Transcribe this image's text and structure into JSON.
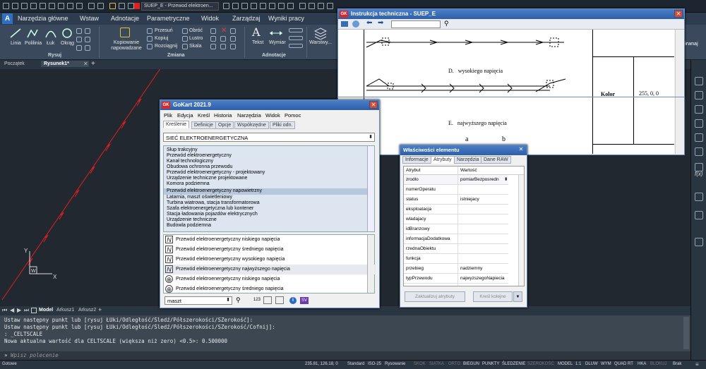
{
  "app": {
    "doc_title": "SUEP_E - Przewod elektroen..."
  },
  "ribbon_tabs": [
    "Narzędzia główne",
    "Wstaw",
    "Adnotacje",
    "Parametryczne",
    "Widok",
    "Zarządzaj",
    "Wyniki pracy"
  ],
  "ribbon": {
    "rysuj": {
      "label": "Rysuj",
      "items": [
        "Linia",
        "Polilinia",
        "Łuk",
        "Okrąg"
      ]
    },
    "zmiana": {
      "label": "Zmiana",
      "items": [
        "Przesuń",
        "Kopiuj",
        "Rozciągnij",
        "Obróć",
        "Lustro",
        "Skala"
      ],
      "copy_label": "Kopiowanie napowadzane"
    },
    "adnotacje": {
      "label": "Adnotacje",
      "items": [
        "Tekst",
        "Wymiar"
      ]
    },
    "warstwy": "Warstwy...",
    "right_cut": "órwnaj"
  },
  "doc_tabs": [
    "Początek",
    "Rysunek1*"
  ],
  "layout_tabs": [
    "Model",
    "Arkusz1",
    "Arkusz2"
  ],
  "command": {
    "lines": [
      "Ustaw następny punkt lub [rysuj ŁUki/Odległość/Śledź/Półszerokości/SZerokość]:",
      "Ustaw następny punkt lub [rysuj ŁUki/Odległość/Śledź/Półszerokości/SZerokość/Cofnij]:",
      ": _CELTSCALE",
      "Nowa aktualna wartość dla CELTSCALE (większa niż zero) <0.5>: 0.500000"
    ],
    "placeholder": "Wpisz polecenie"
  },
  "status": {
    "left": "Gotowe",
    "coords": "235.81, 126.18, 0",
    "items": [
      "Standard",
      "ISO-25",
      "Rysowanie",
      "SKOK",
      "SIATKA",
      "ORTO",
      "BIEGUN",
      "PUNKTY",
      "ŚLEDZENIE",
      "SZEROKOŚĆ",
      "MODEL",
      "1:1",
      "DLUW",
      "WYM",
      "QUAD",
      "RT",
      "HKA",
      "BLOKUJ",
      "Brak"
    ]
  },
  "instr": {
    "title": "Instrukcja techniczna - SUEP_E",
    "caption_d": "D.   wysokiego napięcia",
    "caption_e": "E.   najwyższego napięcia",
    "kolor": "Kolor RGB",
    "rgb": "255, 0, 0",
    "a": "a",
    "b": "b"
  },
  "gokart": {
    "title": "GoKart 2021.9",
    "menu": [
      "Plik",
      "Edycja",
      "Kreśl",
      "Historia",
      "Narzędzia",
      "Widok",
      "Pomoc"
    ],
    "tabs": [
      "Kreślenie",
      "Definicje",
      "Opcje",
      "Współrzędne",
      "Pliki odn."
    ],
    "category": "SIEĆ ELEKTROENERGETYCZNA",
    "items": [
      "Słup trakcyjny",
      "Przewód elektroenergetyczny",
      "Kanał technologiczny",
      "Obudowa ochronna przewodu",
      "Przewód elektroenergetyczny - projektowany",
      "Urządzenie techniczne projektowane",
      "Komora podziemna",
      "Przewód elektroenergetyczny napowietrzny",
      "Latarnia, maszt oświetleniowy",
      "Turbina wiatrowa, stacja transformatorowa",
      "Szafa elektroenergetyczna lub kontener",
      "Stacja ładowania pojazdów elektrycznych",
      "Urządzenie techniczne",
      "Budowla podziemna"
    ],
    "selected": "Przewód elektroenergetyczny napowietrzny",
    "symbols": [
      "Przewód elektroenergetyczny niskiego napięcia",
      "Przewód elektroenergetyczny średniego napięcia",
      "Przewód elektroenergetyczny wysokiego napięcia",
      "Przewód elektroenergetyczny najwyższego napięcia",
      "Przewód elektroenergetyczny niskiego napięcia",
      "Przewód elektroenergetyczny średniego napięcia"
    ],
    "search": "maszt"
  },
  "props": {
    "title": "Właściwości elementu",
    "tabs": [
      "Informacje",
      "Atrybuty",
      "Narzędzia",
      "Dane RAW"
    ],
    "col_attr": "Atrybut",
    "col_val": "Wartość",
    "rows": [
      [
        "zrodlo",
        "pomiarBezposredn"
      ],
      [
        "numerOperatu",
        ""
      ],
      [
        "status",
        "istniejacy"
      ],
      [
        "eksploatacja",
        ""
      ],
      [
        "wladajacy",
        ""
      ],
      [
        "idBranzowy",
        ""
      ],
      [
        "informacjaDodatkowa",
        ""
      ],
      [
        "rzednaObiektu",
        ""
      ],
      [
        "funkcja",
        ""
      ],
      [
        "przebieg",
        "nadziemny"
      ],
      [
        "typPrzewodu",
        "najwyzszegoNapiecia"
      ]
    ],
    "btn_update": "Zaktualizuj atrybuty",
    "btn_next": "Kreśl kolejne"
  }
}
